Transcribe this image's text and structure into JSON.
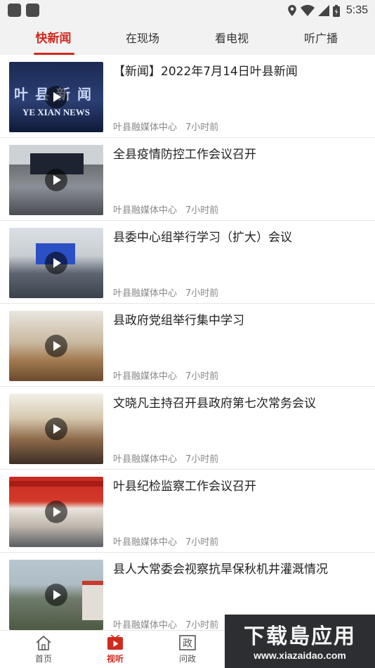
{
  "status_bar": {
    "time": "5:35",
    "icons": [
      "app-icon",
      "app-icon",
      "location-icon",
      "wifi-icon",
      "signal-icon",
      "battery-icon"
    ]
  },
  "tabs": [
    {
      "label": "快新闻",
      "active": true
    },
    {
      "label": "在现场",
      "active": false
    },
    {
      "label": "看电视",
      "active": false
    },
    {
      "label": "听广播",
      "active": false
    }
  ],
  "accent_color": "#d12a1f",
  "news": [
    {
      "title": "【新闻】2022年7月14日叶县新闻",
      "source": "叶县融媒体中心",
      "time": "7小时前",
      "thumb_text_cn": "叶县新闻",
      "thumb_text_en": "YE XIAN NEWS"
    },
    {
      "title": "全县疫情防控工作会议召开",
      "source": "叶县融媒体中心",
      "time": "7小时前"
    },
    {
      "title": "县委中心组举行学习（扩大）会议",
      "source": "叶县融媒体中心",
      "time": "7小时前"
    },
    {
      "title": "县政府党组举行集中学习",
      "source": "叶县融媒体中心",
      "time": "7小时前"
    },
    {
      "title": "文晓凡主持召开县政府第七次常务会议",
      "source": "叶县融媒体中心",
      "time": "7小时前"
    },
    {
      "title": "叶县纪检监察工作会议召开",
      "source": "叶县融媒体中心",
      "time": "7小时前"
    },
    {
      "title": "县人大常委会视察抗旱保秋机井灌溉情况",
      "source": "叶县融媒体中心",
      "time": "7小时前"
    }
  ],
  "bottom_nav": [
    {
      "label": "首页",
      "icon": "home-icon",
      "active": false
    },
    {
      "label": "视听",
      "icon": "video-icon",
      "active": true
    },
    {
      "label": "问政",
      "icon": "politics-icon",
      "active": false
    }
  ],
  "watermark": {
    "main": "下载島应用",
    "sub": "www.xiazaidao.com"
  }
}
